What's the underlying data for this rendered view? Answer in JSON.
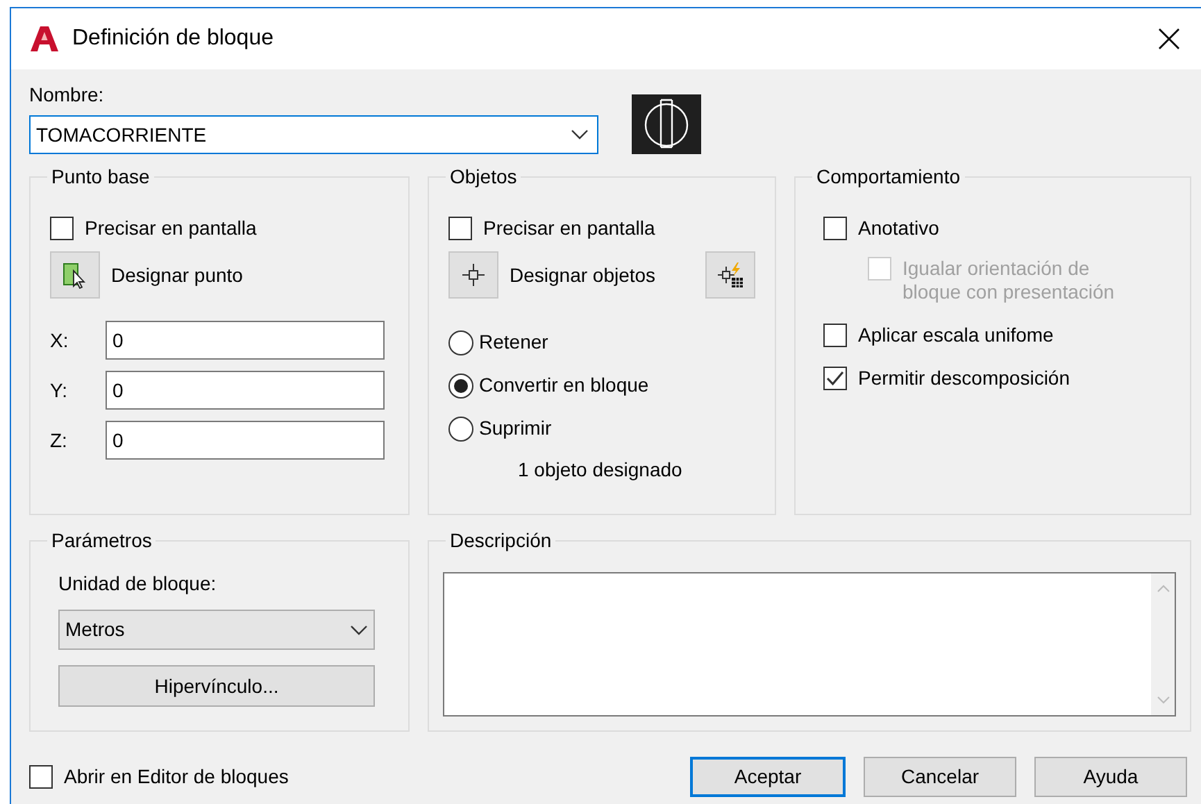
{
  "window": {
    "title": "Definición de bloque"
  },
  "name_field": {
    "label": "Nombre:",
    "value": "TOMACORRIENTE"
  },
  "base_point": {
    "title": "Punto base",
    "specify_on_screen": {
      "label": "Precisar en pantalla",
      "checked": false
    },
    "pick_button": "Designar punto",
    "coords": [
      {
        "label": "X:",
        "value": "0"
      },
      {
        "label": "Y:",
        "value": "0"
      },
      {
        "label": "Z:",
        "value": "0"
      }
    ]
  },
  "objects": {
    "title": "Objetos",
    "specify_on_screen": {
      "label": "Precisar en pantalla",
      "checked": false
    },
    "select_button": "Designar objetos",
    "options": [
      {
        "label": "Retener",
        "selected": false
      },
      {
        "label": "Convertir en bloque",
        "selected": true
      },
      {
        "label": "Suprimir",
        "selected": false
      }
    ],
    "status": "1 objeto designado"
  },
  "behavior": {
    "title": "Comportamiento",
    "options": [
      {
        "label": "Anotativo",
        "checked": false,
        "disabled": false,
        "children": [
          {
            "label": "Igualar orientación de bloque con presentación",
            "checked": false,
            "disabled": true
          }
        ]
      },
      {
        "label": "Aplicar escala unifome",
        "checked": false,
        "disabled": false
      },
      {
        "label": "Permitir descomposición",
        "checked": true,
        "disabled": false
      }
    ]
  },
  "settings": {
    "title": "Parámetros",
    "unit_label": "Unidad de bloque:",
    "unit_value": "Metros",
    "hyperlink_button": "Hipervínculo..."
  },
  "description": {
    "title": "Descripción"
  },
  "open_in_editor": {
    "label": "Abrir en Editor de bloques",
    "checked": false
  },
  "buttons": [
    {
      "label": "Aceptar",
      "default": true
    },
    {
      "label": "Cancelar",
      "default": false
    },
    {
      "label": "Ayuda",
      "default": false
    }
  ]
}
